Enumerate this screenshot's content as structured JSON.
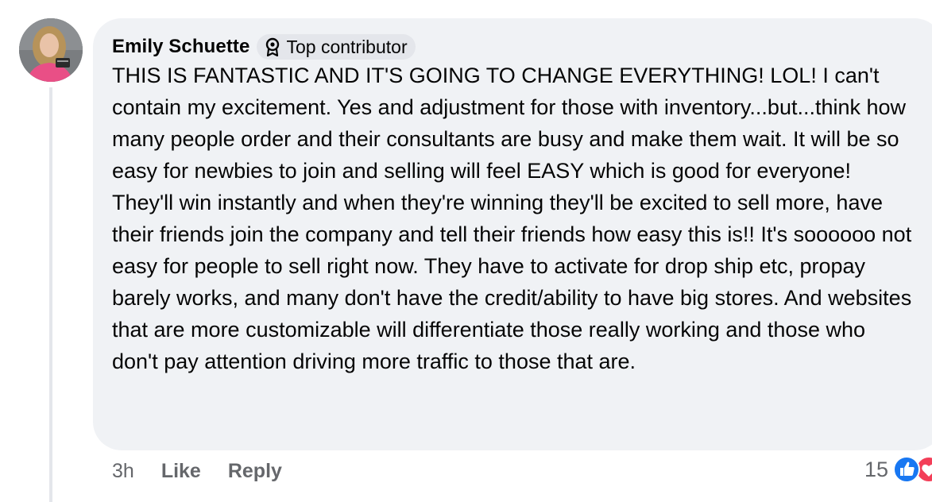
{
  "comment": {
    "author": "Emily Schuette",
    "badge_label": "Top contributor",
    "badge_icon": "badge-award-icon",
    "avatar_icon": "user-avatar",
    "text": "THIS IS FANTASTIC AND IT'S GOING TO CHANGE EVERYTHING! LOL! I can't contain my excitement. Yes and adjustment for those with inventory...but...think how many people order and their consultants are busy and make them wait. It will be so easy for newbies to join and selling will feel EASY which is good for everyone! They'll win instantly and when they're winning they'll be excited to sell more, have their friends join the company and tell their friends how easy this is!! It's soooooo not easy for people to sell right now. They have to activate for drop ship etc, propay barely works, and many don't have the credit/ability to have big stores. And websites that are more customizable will differentiate those really working and those who don't pay attention driving more traffic to those that are.",
    "timestamp": "3h",
    "like_label": "Like",
    "reply_label": "Reply",
    "reaction_count": "15",
    "reaction_icons": [
      "like-reaction-icon",
      "love-reaction-icon"
    ]
  },
  "colors": {
    "bubble_bg": "#f0f2f5",
    "text": "#050505",
    "secondary_text": "#65676b",
    "like_blue": "#1877f2",
    "love_red": "#f33e58"
  }
}
